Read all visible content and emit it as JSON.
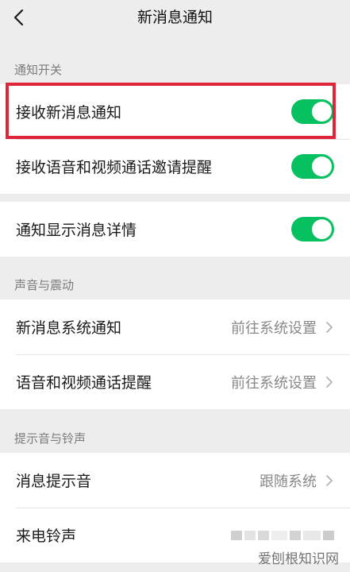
{
  "nav": {
    "title": "新消息通知"
  },
  "sections": {
    "notify_switch": {
      "header": "通知开关",
      "receive_new": "接收新消息通知",
      "receive_call": "接收语音和视频通话邀请提醒",
      "show_detail": "通知显示消息详情"
    },
    "sound_vibrate": {
      "header": "声音与震动",
      "new_msg_sys": "新消息系统通知",
      "new_msg_sys_value": "前往系统设置",
      "call_reminder": "语音和视频通话提醒",
      "call_reminder_value": "前往系统设置"
    },
    "ringtone": {
      "header": "提示音与铃声",
      "msg_tone": "消息提示音",
      "msg_tone_value": "跟随系统",
      "ringtone": "来电铃声"
    }
  },
  "toggles": {
    "receive_new": true,
    "receive_call": true,
    "show_detail": true
  },
  "watermark": "爱刨根知识网",
  "colors": {
    "accent_green": "#07c160",
    "highlight_red": "#e0253b",
    "background": "#ededed"
  },
  "icons": {
    "back": "chevron-left-icon",
    "row_arrow": "chevron-right-icon"
  }
}
